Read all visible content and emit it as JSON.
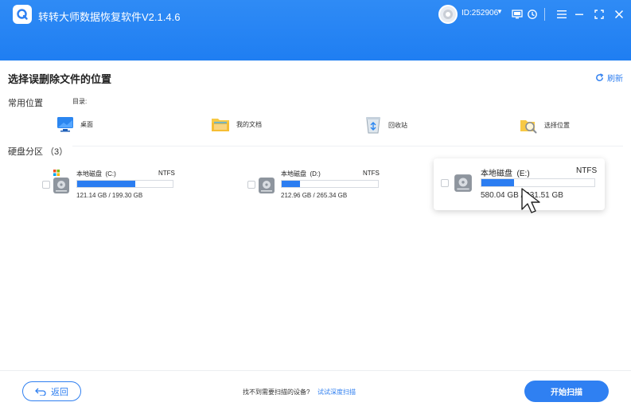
{
  "app": {
    "title": "转转大师数据恢复软件V2.1.4.6",
    "user_id": "ID:252906",
    "accent_color": "#2f80f2",
    "titlebar_icons": [
      "monitor-icon",
      "support-icon",
      "menu-icon",
      "minimize-icon",
      "maximize-icon",
      "close-icon"
    ]
  },
  "page": {
    "title": "选择误删除文件的位置",
    "refresh_label": "刷新"
  },
  "common": {
    "label": "常用位置",
    "dir_label": "目录:",
    "locations": [
      {
        "label": "桌面",
        "icon": "desktop-icon"
      },
      {
        "label": "我的文档",
        "icon": "documents-folder-icon"
      },
      {
        "label": "回收站",
        "icon": "recycle-bin-icon"
      },
      {
        "label": "选择位置",
        "icon": "choose-location-icon"
      }
    ]
  },
  "disks": {
    "label": "硬盘分区 （3）",
    "items": [
      {
        "name": "本地磁盘  (C:)",
        "fs": "NTFS",
        "size": "121.14 GB / 199.30 GB",
        "used_fraction": 0.61
      },
      {
        "name": "本地磁盘  (D:)",
        "fs": "NTFS",
        "size": "212.96 GB / 265.34 GB",
        "used_fraction": 0.19
      },
      {
        "name": "本地磁盘  (E:)",
        "fs": "NTFS",
        "size": "580.04 GB / 931.51 GB",
        "used_fraction": 0.29
      }
    ]
  },
  "footer": {
    "back_label": "返回",
    "message": "找不到需要扫描的设备?",
    "link": "试试深度扫描",
    "start_label": "开始扫描"
  }
}
